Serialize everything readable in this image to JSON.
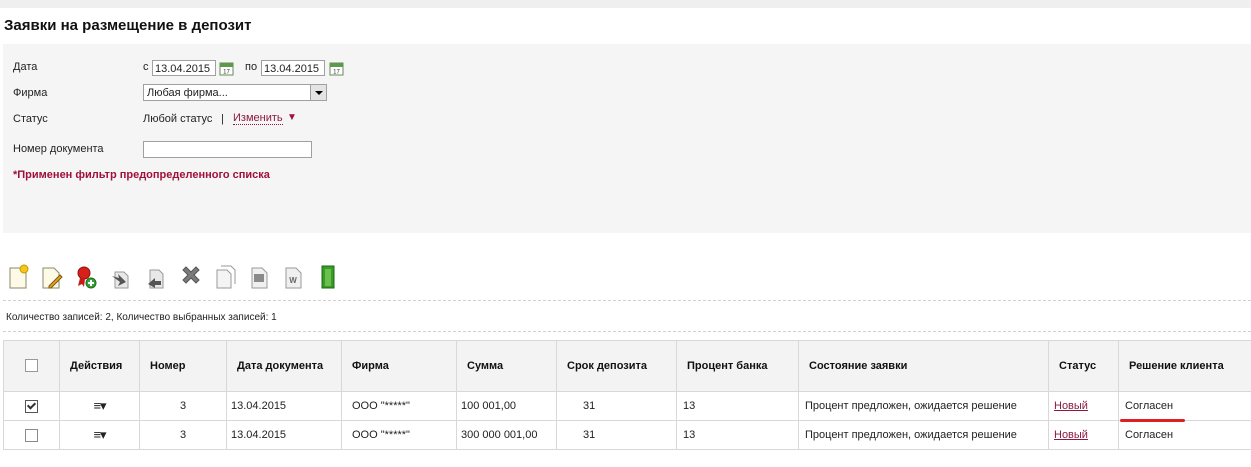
{
  "page": {
    "title": "Заявки на размещение в депозит"
  },
  "filter": {
    "date_label": "Дата",
    "from_prefix": "с",
    "from_value": "13.04.2015",
    "to_prefix": "по",
    "to_value": "13.04.2015",
    "firm_label": "Фирма",
    "firm_value": "Любая фирма...",
    "status_label": "Статус",
    "status_value": "Любой статус",
    "status_separator": "|",
    "change_link": "Изменить",
    "change_arrow": "▼",
    "doc_number_label": "Номер документа",
    "doc_number_value": "",
    "note": "*Применен фильтр предопределенного списка"
  },
  "toolbar": {
    "icons": [
      "new-document-icon",
      "edit-document-icon",
      "sign-document-icon",
      "send-icon",
      "receive-icon",
      "delete-icon",
      "copy-icon",
      "export-pdf-icon",
      "export-word-icon",
      "exit-icon"
    ]
  },
  "summary": {
    "text": "Количество записей: 2, Количество выбранных записей: 1"
  },
  "table": {
    "headers": [
      "",
      "Действия",
      "Номер",
      "Дата документа",
      "Фирма",
      "Сумма",
      "Срок депозита",
      "Процент банка",
      "Состояние заявки",
      "Статус",
      "Решение клиента"
    ],
    "rows": [
      {
        "checked": true,
        "actions": "≡▾",
        "number": "3",
        "date": "13.04.2015",
        "firm": "ООО \"*****\"",
        "sum": "100 001,00",
        "term": "31",
        "rate": "13",
        "state": "Процент предложен, ожидается решение",
        "status": "Новый",
        "decision": "Согласен"
      },
      {
        "checked": false,
        "actions": "≡▾",
        "number": "3",
        "date": "13.04.2015",
        "firm": "ООО \"*****\"",
        "sum": "300 000 001,00",
        "term": "31",
        "rate": "13",
        "state": "Процент предложен, ожидается решение",
        "status": "Новый",
        "decision": "Согласен"
      }
    ]
  },
  "colors": {
    "accent": "#8b1a3e",
    "panel_bg": "#f5f5f5",
    "mark": "#e02020"
  }
}
